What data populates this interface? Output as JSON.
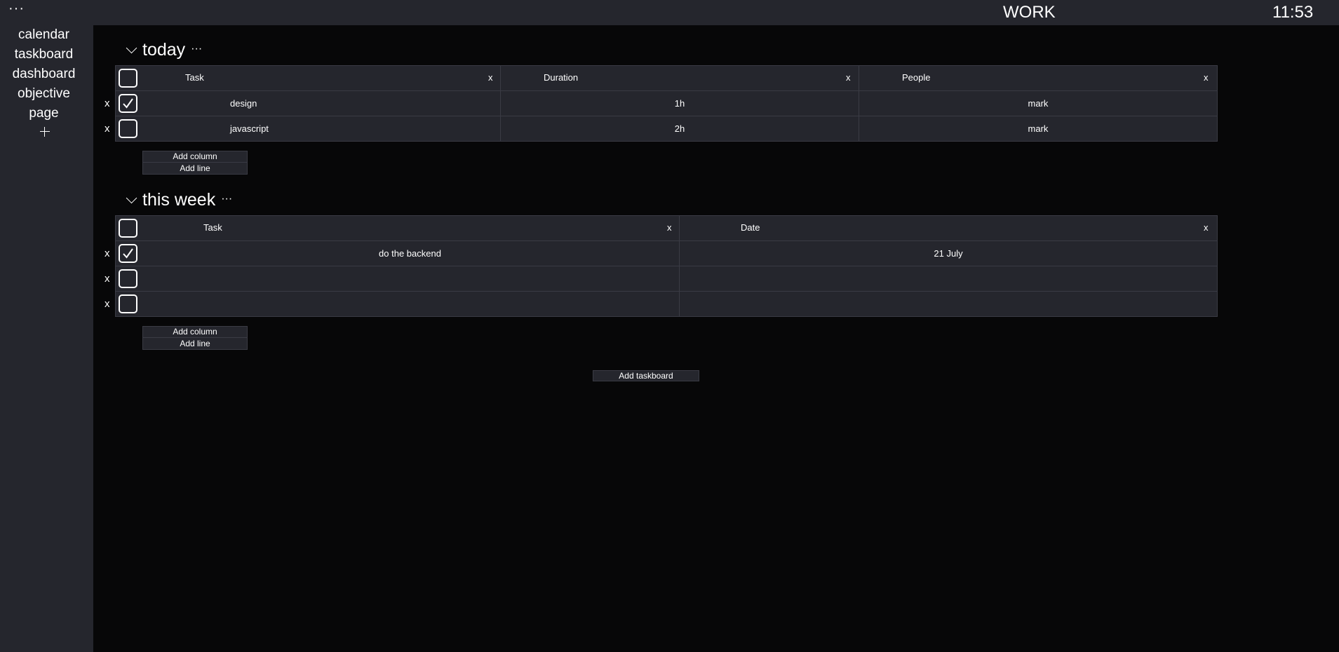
{
  "topbar": {
    "menu_icon": "more-dots-icon",
    "menu_label": "···",
    "title": "WORK",
    "clock": "11:53"
  },
  "sidebar": {
    "items": [
      {
        "label": "calendar"
      },
      {
        "label": "taskboard"
      },
      {
        "label": "dashboard"
      },
      {
        "label": "objective"
      },
      {
        "label": "page"
      }
    ],
    "add_icon": "plus-icon"
  },
  "boards": [
    {
      "title": "today",
      "dots": "···",
      "columns": [
        {
          "label": "Task",
          "x": "x"
        },
        {
          "label": "Duration",
          "x": "x"
        },
        {
          "label": "People",
          "x": "x"
        }
      ],
      "rows": [
        {
          "x": "x",
          "checked": true,
          "cells": [
            "design",
            "1h",
            "mark"
          ]
        },
        {
          "x": "x",
          "checked": false,
          "cells": [
            "javascript",
            "2h",
            "mark"
          ]
        }
      ],
      "add_column": "Add column",
      "add_line": "Add line"
    },
    {
      "title": "this week",
      "dots": "···",
      "columns": [
        {
          "label": "Task",
          "x": "x"
        },
        {
          "label": "Date",
          "x": "x"
        }
      ],
      "rows": [
        {
          "x": "x",
          "checked": true,
          "cells": [
            "do the backend",
            "21 July"
          ]
        },
        {
          "x": "x",
          "checked": false,
          "cells": [
            "",
            ""
          ]
        },
        {
          "x": "x",
          "checked": false,
          "cells": [
            "",
            ""
          ]
        }
      ],
      "add_column": "Add column",
      "add_line": "Add line"
    }
  ],
  "add_taskboard": "Add taskboard",
  "colors": {
    "panel": "#25262d",
    "background": "#070708",
    "border": "#3a3b44",
    "text": "#ffffff"
  }
}
